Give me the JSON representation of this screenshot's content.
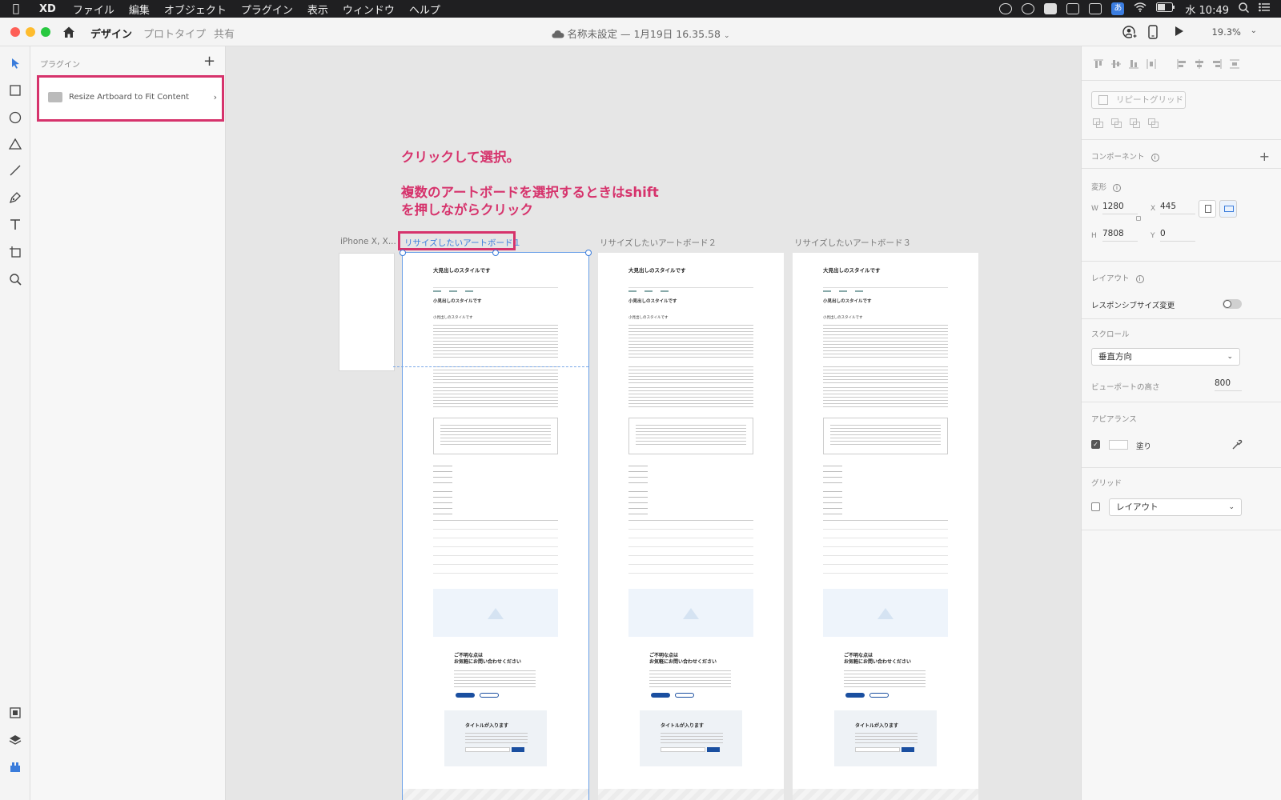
{
  "menubar": {
    "app": "XD",
    "menus": [
      "ファイル",
      "編集",
      "オブジェクト",
      "プラグイン",
      "表示",
      "ウィンドウ",
      "ヘルプ"
    ],
    "input_method": "あ",
    "clock": "水 10:49"
  },
  "titlebar": {
    "tabs": [
      "デザイン",
      "プロトタイプ",
      "共有"
    ],
    "doc_title": "名称未設定 — 1月19日 16.35.58",
    "zoom": "19.3%"
  },
  "plugins": {
    "heading": "プラグイン",
    "add": "+",
    "item_label": "Resize Artboard to Fit Content"
  },
  "canvas": {
    "annotation1": "クリックして選択。",
    "annotation2_line1": "複数のアートボードを選択するときはshift",
    "annotation2_line2": "を押しながらクリック",
    "artboard_labels": [
      "iPhone X, X...",
      "リサイズしたいアートボード１",
      "リサイズしたいアートボード２",
      "リサイズしたいアートボード３"
    ],
    "page": {
      "h1": "大見出しのスタイルです",
      "h2": "小見出しのスタイルです",
      "h3": "小見出しのスタイルです",
      "cta_line1": "ご不明な点は",
      "cta_line2": "お気軽にお問い合わせください",
      "card_title": "タイトルが入ります"
    }
  },
  "inspector": {
    "repeat_grid": "リピートグリッド",
    "component": "コンポーネント",
    "transform": "変形",
    "w_label": "W",
    "w_value": "1280",
    "x_label": "X",
    "x_value": "445",
    "h_label": "H",
    "h_value": "7808",
    "y_label": "Y",
    "y_value": "0",
    "layout": "レイアウト",
    "responsive": "レスポンシブサイズ変更",
    "scroll": "スクロール",
    "scroll_value": "垂直方向",
    "viewport_label": "ビューポートの高さ",
    "viewport_value": "800",
    "appearance": "アピアランス",
    "fill": "塗り",
    "grid": "グリッド",
    "grid_value": "レイアウト"
  },
  "colors": {
    "annotation": "#d6336c",
    "selection": "#3a7cdb",
    "brand_button": "#1a4fa0"
  }
}
